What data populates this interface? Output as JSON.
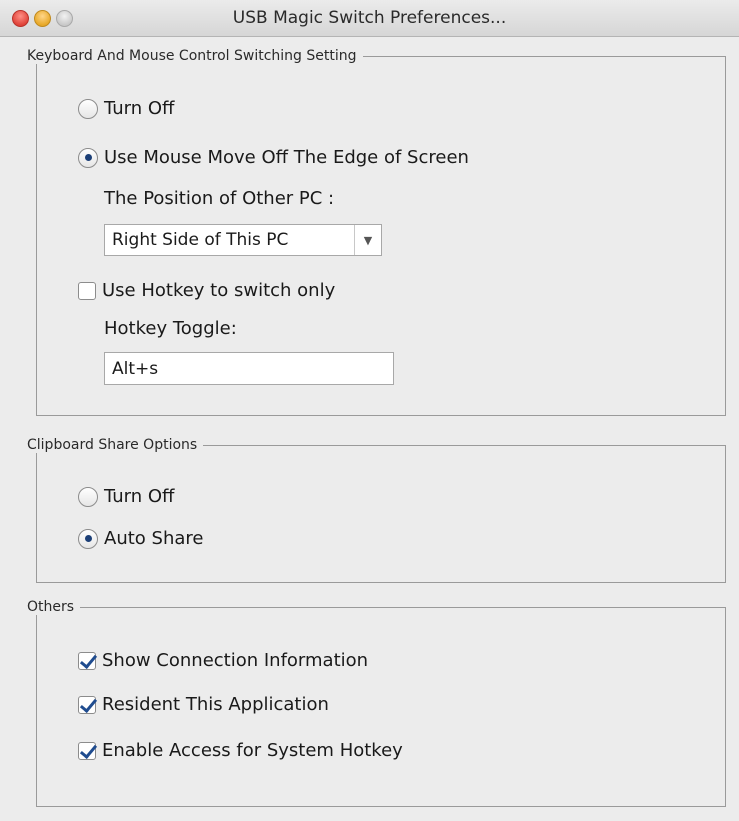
{
  "window": {
    "title": "USB Magic Switch Preferences..."
  },
  "keyboard_section": {
    "legend": "Keyboard And Mouse Control Switching Setting",
    "turn_off": "Turn Off",
    "use_mouse_edge": "Use Mouse Move Off The Edge of Screen",
    "position_label": "The Position of Other PC :",
    "position_value": "Right Side of This PC",
    "use_hotkey": "Use Hotkey to switch only",
    "hotkey_label": "Hotkey Toggle:",
    "hotkey_value": "Alt+s",
    "selected": "use_mouse_edge",
    "hotkey_only_checked": false
  },
  "clipboard_section": {
    "legend": "Clipboard Share Options",
    "turn_off": "Turn Off",
    "auto_share": "Auto Share",
    "selected": "auto_share"
  },
  "others_section": {
    "legend": "Others",
    "items": [
      {
        "label": "Show Connection Information",
        "checked": true
      },
      {
        "label": "Resident This Application",
        "checked": true
      },
      {
        "label": "Enable Access for System Hotkey",
        "checked": true
      }
    ]
  },
  "colors": {
    "accent": "#1c3f77",
    "background": "#ececec"
  }
}
